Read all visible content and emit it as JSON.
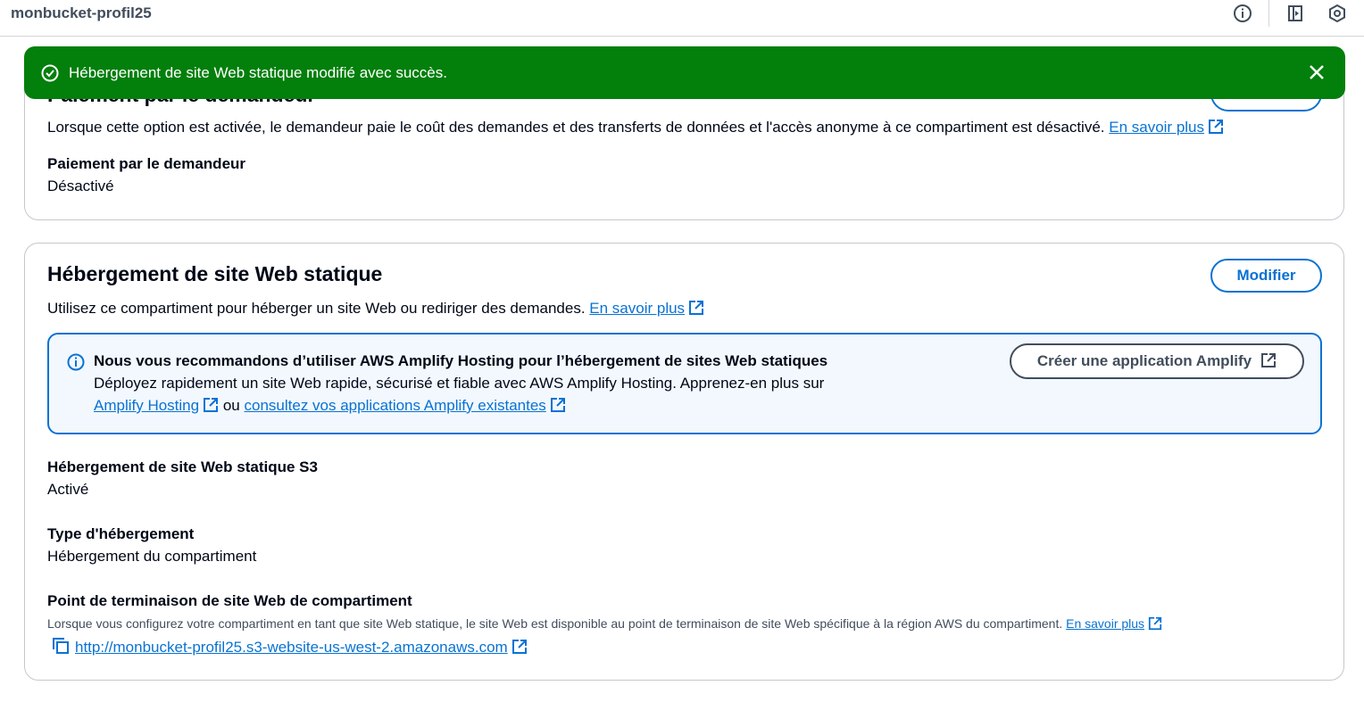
{
  "header": {
    "bucket_name": "monbucket-profil25",
    "icons": [
      "info-icon",
      "panel-toggle-icon",
      "settings-hex-icon"
    ]
  },
  "flash": {
    "message": "Hébergement de site Web statique modifié avec succès.",
    "status_icon": "success-check-icon",
    "dismiss_icon": "close-icon",
    "color": "#037f0c"
  },
  "requester_pays": {
    "title": "Paiement par le demandeur",
    "description": "Lorsque cette option est activée, le demandeur paie le coût des demandes et des transferts de données et l'accès anonyme à ce compartiment est désactivé.",
    "learn_more": "En savoir plus",
    "field_label": "Paiement par le demandeur",
    "field_value": "Désactivé"
  },
  "static_hosting": {
    "title": "Hébergement de site Web statique",
    "edit_label": "Modifier",
    "description": "Utilisez ce compartiment pour héberger un site Web ou rediriger des demandes.",
    "learn_more": "En savoir plus",
    "info": {
      "heading": "Nous vous recommandons d’utiliser AWS Amplify Hosting pour l’hébergement de sites Web statiques",
      "body": "Déployez rapidement un site Web rapide, sécurisé et fiable avec AWS Amplify Hosting. Apprenez-en plus sur",
      "link1": "Amplify Hosting",
      "connector": "ou",
      "link2": "consultez vos applications Amplify existantes",
      "button": "Créer une application Amplify"
    },
    "fields": {
      "s3_label": "Hébergement de site Web statique S3",
      "s3_value": "Activé",
      "type_label": "Type d'hébergement",
      "type_value": "Hébergement du compartiment",
      "endpoint_label": "Point de terminaison de site Web de compartiment",
      "endpoint_desc": "Lorsque vous configurez votre compartiment en tant que site Web statique, le site Web est disponible au point de terminaison de site Web spécifique à la région AWS du compartiment.",
      "endpoint_learn_more": "En savoir plus",
      "endpoint_url": "http://monbucket-profil25.s3-website-us-west-2.amazonaws.com"
    }
  },
  "colors": {
    "link": "#0972d3",
    "info_bg": "#f2f8fd",
    "text": "#000716"
  }
}
